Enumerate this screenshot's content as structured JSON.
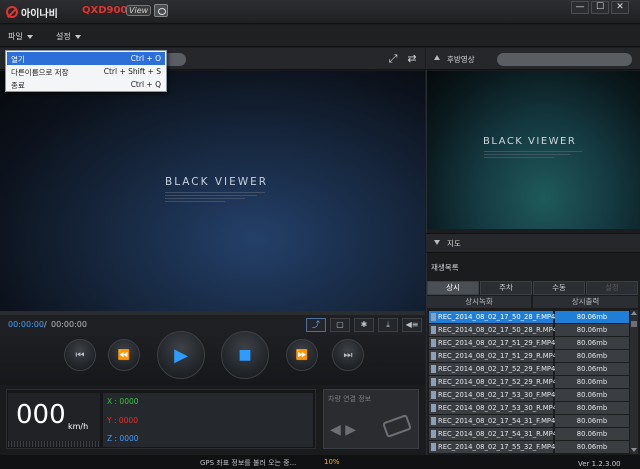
{
  "app": {
    "brand": "아이나비",
    "model": "QXD900",
    "model_tag": "View"
  },
  "window": {
    "minimize": "—",
    "maximize": "☐",
    "close": "✕"
  },
  "menu": {
    "file": "파일",
    "settings": "설정",
    "file_items": [
      {
        "label": "열기",
        "shortcut": "Ctrl + O",
        "selected": true
      },
      {
        "label": "다른이름으로 저장",
        "shortcut": "Ctrl + Shift + S",
        "selected": false
      },
      {
        "label": "종료",
        "shortcut": "Ctrl + Q",
        "selected": false
      }
    ]
  },
  "player": {
    "current_time": "00:00:00",
    "separator": "/",
    "total_time": "00:00:00",
    "front_overlay": "BLACK VIEWER",
    "icons": {
      "fullscreen": "fullscreen-icon",
      "swap": "swap-icon"
    }
  },
  "controls": {
    "prev": "⏮",
    "rewind": "⏪",
    "play": "▶",
    "stop": "■",
    "forward": "⏩",
    "next": "⏭"
  },
  "toolbar": {
    "capture": "⤴",
    "frame": "▢",
    "settings": "✱",
    "download": "⤓",
    "volume": "◀≡"
  },
  "gauge": {
    "speed": "000",
    "unit": "km/h",
    "x_label": "X : 0000",
    "y_label": "Y : 0000",
    "z_label": "Z : 0000",
    "colors": {
      "x": "#34c442",
      "y": "#e5322d",
      "z": "#3f9cff"
    }
  },
  "vehicle": {
    "title": "차량 연결 정보"
  },
  "status": {
    "gps_text": "GPS 좌표 정보를 불러 오는 중...",
    "gps_percent": "10%",
    "version": "Ver 1.2.3.00"
  },
  "right": {
    "rear_label": "후방영상",
    "rear_overlay": "BLACK VIEWER",
    "map_label": "지도",
    "playlist_title": "재생목록",
    "tabs": [
      {
        "label": "상시",
        "state": "active"
      },
      {
        "label": "주차",
        "state": "normal"
      },
      {
        "label": "수동",
        "state": "normal"
      },
      {
        "label": "설정",
        "state": "disabled"
      }
    ],
    "columns": [
      "상시녹화",
      "상시출력"
    ],
    "files": [
      {
        "name": "REC_2014_08_02_17_50_28_F.MP4",
        "size": "80.06mb",
        "selected": true
      },
      {
        "name": "REC_2014_08_02_17_50_28_R.MP4",
        "size": "80.06mb",
        "selected": false
      },
      {
        "name": "REC_2014_08_02_17_51_29_F.MP4",
        "size": "80.06mb",
        "selected": false
      },
      {
        "name": "REC_2014_08_02_17_51_29_R.MP4",
        "size": "80.06mb",
        "selected": false
      },
      {
        "name": "REC_2014_08_02_17_52_29_F.MP4",
        "size": "80.06mb",
        "selected": false
      },
      {
        "name": "REC_2014_08_02_17_52_29_R.MP4",
        "size": "80.06mb",
        "selected": false
      },
      {
        "name": "REC_2014_08_02_17_53_30_F.MP4",
        "size": "80.06mb",
        "selected": false
      },
      {
        "name": "REC_2014_08_02_17_53_30_R.MP4",
        "size": "80.06mb",
        "selected": false
      },
      {
        "name": "REC_2014_08_02_17_54_31_F.MP4",
        "size": "80.06mb",
        "selected": false
      },
      {
        "name": "REC_2014_08_02_17_54_31_R.MP4",
        "size": "80.06mb",
        "selected": false
      },
      {
        "name": "REC_2014_08_02_17_55_32_F.MP4",
        "size": "80.06mb",
        "selected": false
      }
    ]
  }
}
